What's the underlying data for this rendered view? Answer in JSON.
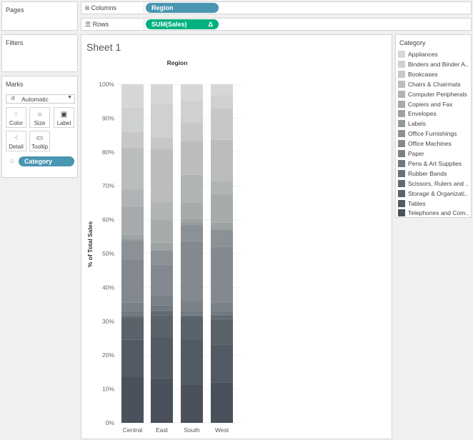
{
  "panels": {
    "pages": "Pages",
    "filters": "Filters",
    "marks": "Marks"
  },
  "shelves": {
    "columns_label": "Columns",
    "columns_pill": "Region",
    "rows_label": "Rows",
    "rows_pill": "SUM(Sales)",
    "rows_delta": "Δ"
  },
  "marks": {
    "type": "Automatic",
    "buttons": [
      "Color",
      "Size",
      "Label",
      "Detail",
      "Tooltip"
    ],
    "color_pill": "Category"
  },
  "colors": {
    "columns_pill": "#4996b2",
    "rows_pill": "#00b180"
  },
  "sheet": {
    "title": "Sheet 1"
  },
  "legend": {
    "title": "Category",
    "items": [
      "Appliances",
      "Binders and Binder A..",
      "Bookcases",
      "Chairs & Chairmats",
      "Computer Peripherals",
      "Copiers and Fax",
      "Envelopes",
      "Labels",
      "Office Furnishings",
      "Office Machines",
      "Paper",
      "Pens & Art Supplies",
      "Rubber Bands",
      "Scissors, Rulers and ..",
      "Storage & Organizati..",
      "Tables",
      "Telephones and Com.."
    ]
  },
  "chart_data": {
    "type": "bar",
    "stacked": true,
    "title": "Region",
    "ylabel": "% of Total Sales",
    "ylim": [
      0,
      100
    ],
    "yticks": [
      "0%",
      "10%",
      "20%",
      "30%",
      "40%",
      "50%",
      "60%",
      "70%",
      "80%",
      "90%",
      "100%"
    ],
    "categories": [
      "Central",
      "East",
      "South",
      "West"
    ],
    "series": [
      {
        "name": "Appliances",
        "color": "#d7d7d7",
        "values": [
          6.8,
          5.7,
          4.9,
          3.2
        ]
      },
      {
        "name": "Binders and Binder Accessories",
        "color": "#cfd0d0",
        "values": [
          7.3,
          10.3,
          6.7,
          4.0
        ]
      },
      {
        "name": "Bookcases",
        "color": "#c6c7c7",
        "values": [
          4.7,
          3.4,
          5.3,
          9.3
        ]
      },
      {
        "name": "Chairs & Chairmats",
        "color": "#bbbcbc",
        "values": [
          12.2,
          15.8,
          10.1,
          12.2
        ]
      },
      {
        "name": "Computer Peripherals",
        "color": "#b1b4b4",
        "values": [
          5.0,
          5.5,
          8.2,
          3.8
        ]
      },
      {
        "name": "Copiers and Fax",
        "color": "#a7abab",
        "values": [
          8.5,
          6.8,
          4.9,
          8.6
        ]
      },
      {
        "name": "Envelopes",
        "color": "#9da2a3",
        "values": [
          1.2,
          2.1,
          1.3,
          1.6
        ]
      },
      {
        "name": "Labels",
        "color": "#949a9c",
        "values": [
          0.5,
          0.4,
          0.4,
          0.5
        ]
      },
      {
        "name": "Office Furnishings",
        "color": "#8b9195",
        "values": [
          5.5,
          4.0,
          5.0,
          5.0
        ]
      },
      {
        "name": "Office Machines",
        "color": "#83898e",
        "values": [
          12.7,
          9.3,
          17.8,
          16.5
        ]
      },
      {
        "name": "Paper",
        "color": "#7a8187",
        "values": [
          2.5,
          2.9,
          2.9,
          2.7
        ]
      },
      {
        "name": "Pens & Art Supplies",
        "color": "#717980",
        "values": [
          1.1,
          1.5,
          1.1,
          1.0
        ]
      },
      {
        "name": "Rubber Bands",
        "color": "#697178",
        "values": [
          0.4,
          0.3,
          0.3,
          0.3
        ]
      },
      {
        "name": "Scissors, Rulers and Trimmers",
        "color": "#626a71",
        "values": [
          0.8,
          1.2,
          0.6,
          1.0
        ]
      },
      {
        "name": "Storage & Organization",
        "color": "#5a626a",
        "values": [
          6.3,
          6.6,
          6.5,
          7.6
        ]
      },
      {
        "name": "Tables",
        "color": "#525a63",
        "values": [
          11.0,
          12.4,
          13.5,
          11.2
        ]
      },
      {
        "name": "Telephones and Communication",
        "color": "#4a515b",
        "values": [
          13.5,
          13.3,
          11.4,
          12.0
        ]
      }
    ]
  }
}
